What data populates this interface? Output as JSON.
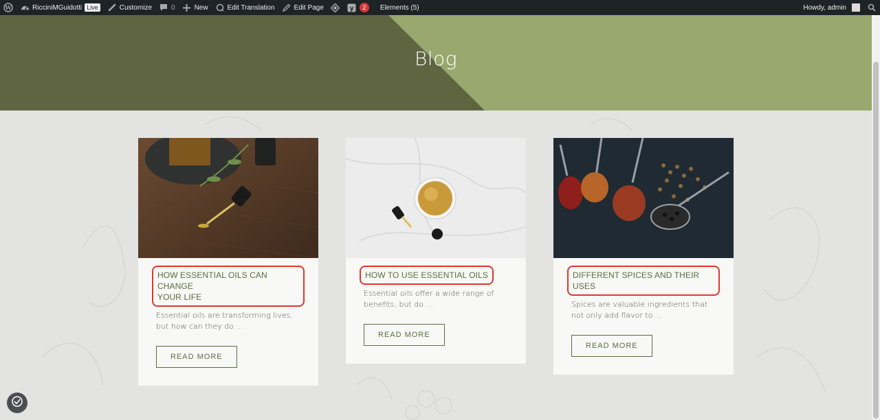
{
  "adminbar": {
    "site_name": "RicciniMGuidotti",
    "live_badge": "Live",
    "customize": "Customize",
    "comments_count": "0",
    "new": "New",
    "edit_translation": "Edit Translation",
    "edit_page": "Edit Page",
    "yoast_count": "2",
    "elements": "Elements (5)",
    "howdy": "Howdy, admin"
  },
  "hero": {
    "title": "Blog"
  },
  "cards": [
    {
      "title_line1": "HOW ESSENTIAL OILS CAN CHANGE",
      "title_line2": "YOUR LIFE",
      "excerpt": "Essential oils are transforming lives, but how can they do ...",
      "button": "READ MORE"
    },
    {
      "title_line1": "HOW TO USE ESSENTIAL OILS",
      "excerpt": "Essential oils offer a wide range of benefits, but do ...",
      "button": "READ MORE"
    },
    {
      "title_line1": "DIFFERENT SPICES AND THEIR USES",
      "excerpt": "Spices are valuable ingredients that not only add flavor to ...",
      "button": "READ MORE"
    }
  ],
  "colors": {
    "adminbar_bg": "#1d2327",
    "hero_light": "#98a86e",
    "hero_dark": "#5e6540",
    "accent": "#5e6a3f",
    "highlight": "#e0362c"
  }
}
